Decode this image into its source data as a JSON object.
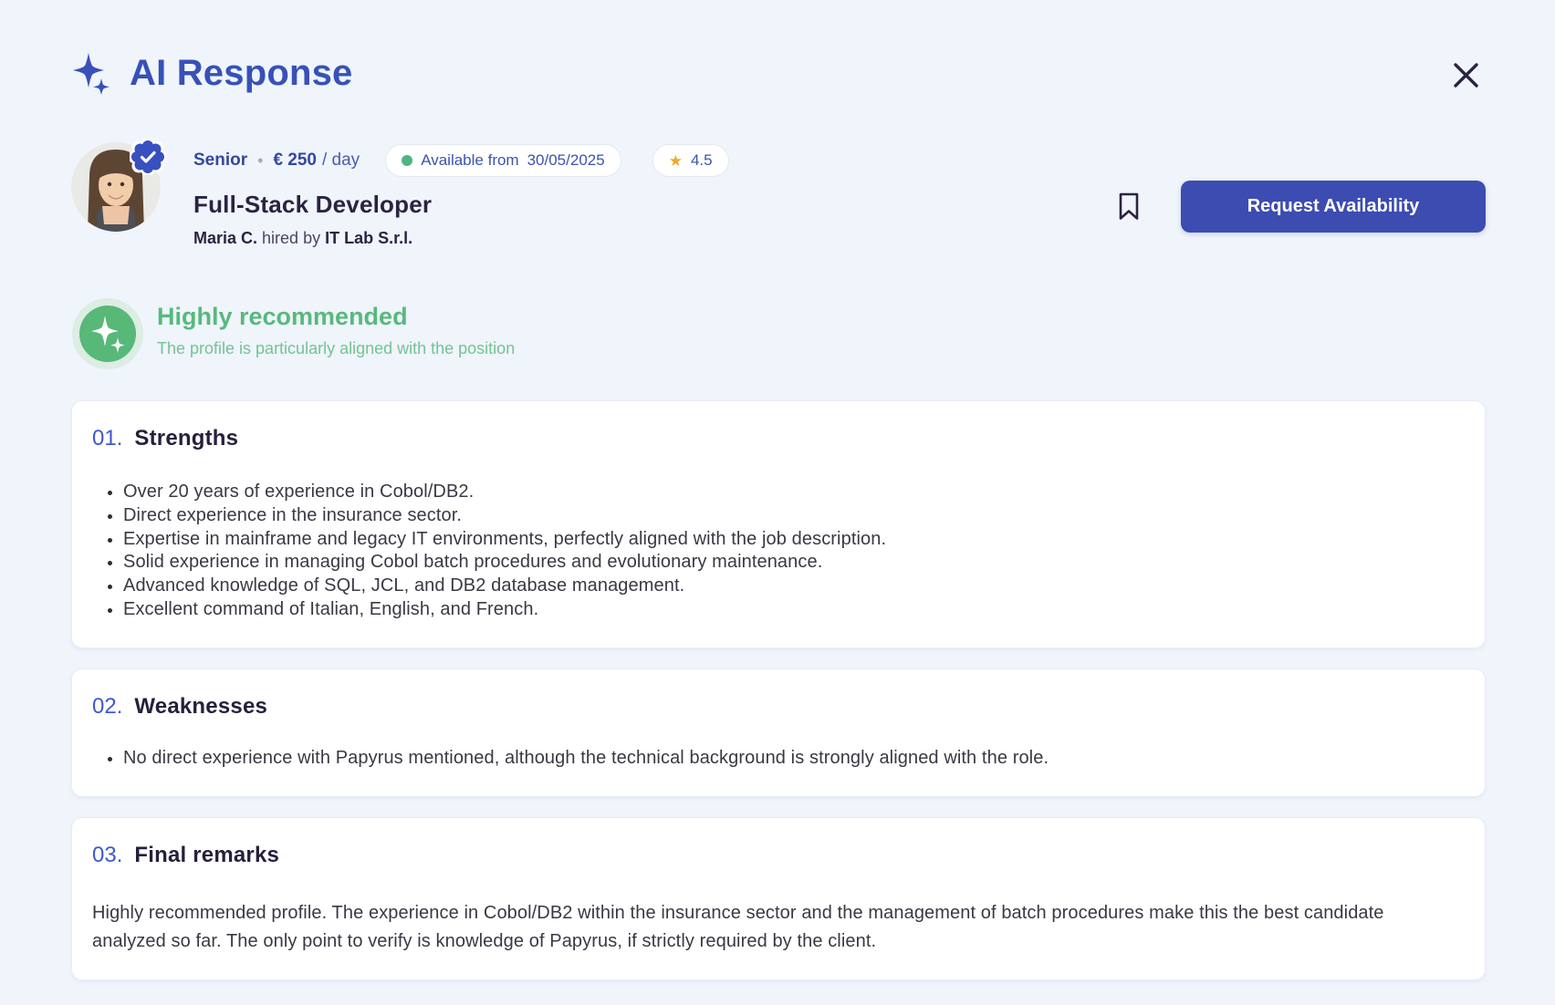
{
  "header": {
    "title": "AI Response"
  },
  "profile": {
    "seniority": "Senior",
    "separator": "•",
    "rate_value": "€ 250",
    "rate_unit": "/ day",
    "availability_label": "Available from",
    "availability_date": "30/05/2025",
    "rating_star": "★",
    "rating_value": "4.5",
    "role": "Full-Stack Developer",
    "name": "Maria C.",
    "hired_by_label": "hired by",
    "company": "IT Lab S.r.l.",
    "request_button_label": "Request Availability"
  },
  "recommendation": {
    "title": "Highly recommended",
    "subtitle": "The profile is particularly aligned with the position"
  },
  "sections": [
    {
      "number": "01.",
      "title": "Strengths",
      "bullets": [
        "Over 20 years of experience in Cobol/DB2.",
        "Direct experience in the insurance sector.",
        "Expertise in mainframe and legacy IT environments, perfectly aligned with the job description.",
        "Solid experience in managing Cobol batch procedures and evolutionary maintenance.",
        "Advanced knowledge of SQL, JCL, and DB2 database management.",
        "Excellent command of Italian, English, and French."
      ]
    },
    {
      "number": "02.",
      "title": "Weaknesses",
      "bullets": [
        "No direct experience with Papyrus mentioned, although the technical background is strongly aligned with the role."
      ]
    },
    {
      "number": "03.",
      "title": "Final remarks",
      "paragraph": "Highly recommended profile. The experience in Cobol/DB2 within the insurance sector and the management of batch procedures make this the best candidate analyzed so far. The only point to verify is knowledge of Papyrus, if strictly required by the client."
    }
  ],
  "icons": {
    "sparkle": "sparkle-icon",
    "close": "close-icon",
    "verified": "verified-badge-icon",
    "bookmark": "bookmark-icon",
    "star": "star-icon",
    "green_dot": "availability-status-dot"
  },
  "colors": {
    "background": "#f0f4fb",
    "accent_blue": "#3751b8",
    "button_blue": "#3c4cb1",
    "deep_blue_text": "#33489f",
    "number_blue": "#3e59cc",
    "navy_text": "#2b2342",
    "body_text": "#3a3844",
    "green_primary": "#57b878",
    "green_text": "#58b97d",
    "green_subtle": "#72c493",
    "star_orange": "#f5a623",
    "card_border": "#e9ecf4",
    "card_bg": "#ffffff"
  }
}
